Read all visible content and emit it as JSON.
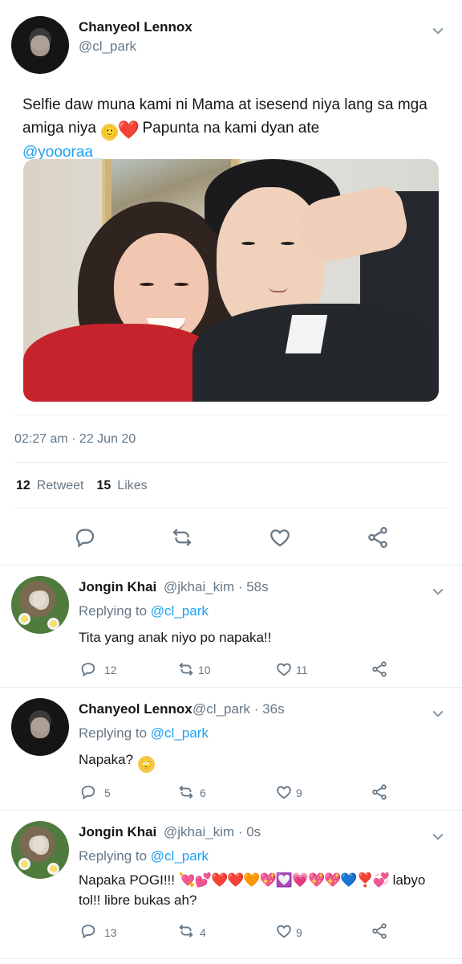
{
  "main_tweet": {
    "author_name": "Chanyeol Lennox",
    "author_handle": "@cl_park",
    "text_prefix": "Selfie daw muna kami ni Mama at isesend niya lang sa mga amiga niya ",
    "text_emojis": [
      "🙂",
      "❤️"
    ],
    "text_suffix": " Papunta na kami dyan ate ",
    "mention": "@yoooraa_",
    "photo_icon": "photo",
    "timestamp": "02:27 am · 22 Jun 20",
    "stats": {
      "retweets_count": "12",
      "retweets_label": "Retweet",
      "likes_count": "15",
      "likes_label": "Likes"
    },
    "actions": [
      "reply-icon",
      "retweet-icon",
      "like-icon",
      "share-icon"
    ]
  },
  "replies": [
    {
      "name": "Jongin Khai",
      "handle": "@jkhai_kim · 58s",
      "replying_label": "Replying to",
      "replying_to": "@cl_park",
      "text": "Tita yang anak niyo po napaka!!",
      "reply_count": "12",
      "retweet_count": "10",
      "like_count": "11"
    },
    {
      "name": "Chanyeol Lennox",
      "handle": "@cl_park · 36s",
      "replying_label": "Replying to",
      "replying_to": "@cl_park",
      "text": "Napaka?",
      "emoji": "🙄",
      "reply_count": "5",
      "retweet_count": "6",
      "like_count": "9"
    },
    {
      "name": "Jongin Khai",
      "handle": "@jkhai_kim · 0s",
      "replying_label": "Replying to",
      "replying_to": "@cl_park",
      "text_prefix": "Napaka POGI!!! ",
      "emojis": "💘💕❤️❤️🧡💖💟💗💖💖💙❣️💞",
      "text_suffix": " labyo tol!! libre bukas ah?",
      "reply_count": "13",
      "retweet_count": "4",
      "like_count": "9"
    }
  ],
  "colors": {
    "text": "#14171a",
    "muted": "#657786",
    "accent": "#1da1f2",
    "divider": "#e6ecf0"
  }
}
